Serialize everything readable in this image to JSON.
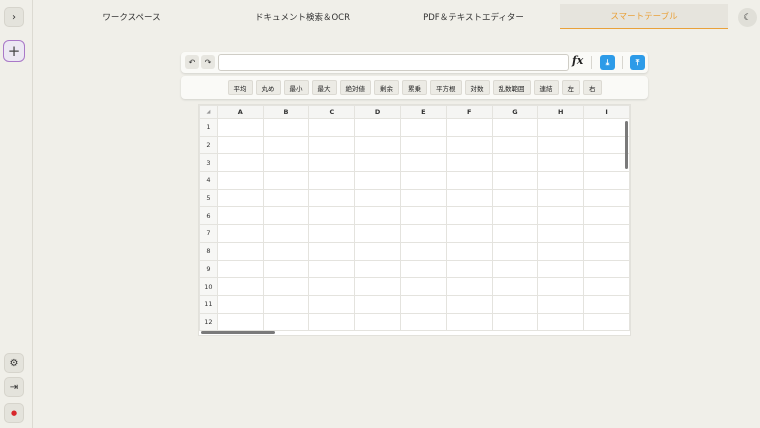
{
  "rail": {
    "top_icon": "›",
    "add_icon": "+",
    "bottom_icons": [
      "⚙",
      "⇥",
      "●"
    ]
  },
  "tabs": [
    {
      "label": "ワークスペース",
      "active": false
    },
    {
      "label": "ドキュメント検索＆OCR",
      "active": false
    },
    {
      "label": "PDF＆テキストエディター",
      "active": false
    },
    {
      "label": "スマートテーブル",
      "active": true
    }
  ],
  "theme_icon": "☾",
  "toolbar": {
    "undo_icon": "↶",
    "redo_icon": "↷",
    "formula_value": "",
    "fx_label": "fx",
    "download_icon": "⤓",
    "upload_icon": "⤒"
  },
  "functions": [
    "平均",
    "丸め",
    "最小",
    "最大",
    "絶対値",
    "剰余",
    "累乗",
    "平方根",
    "対数",
    "乱数範囲",
    "連結",
    "左",
    "右"
  ],
  "sheet": {
    "corner": "◢",
    "columns": [
      "A",
      "B",
      "C",
      "D",
      "E",
      "F",
      "G",
      "H",
      "I"
    ],
    "rows": [
      "1",
      "2",
      "3",
      "4",
      "5",
      "6",
      "7",
      "8",
      "9",
      "10",
      "11",
      "12"
    ]
  },
  "colors": {
    "accent": "#e9a13a",
    "primary": "#2d9be8",
    "add_border": "#a978c8"
  }
}
